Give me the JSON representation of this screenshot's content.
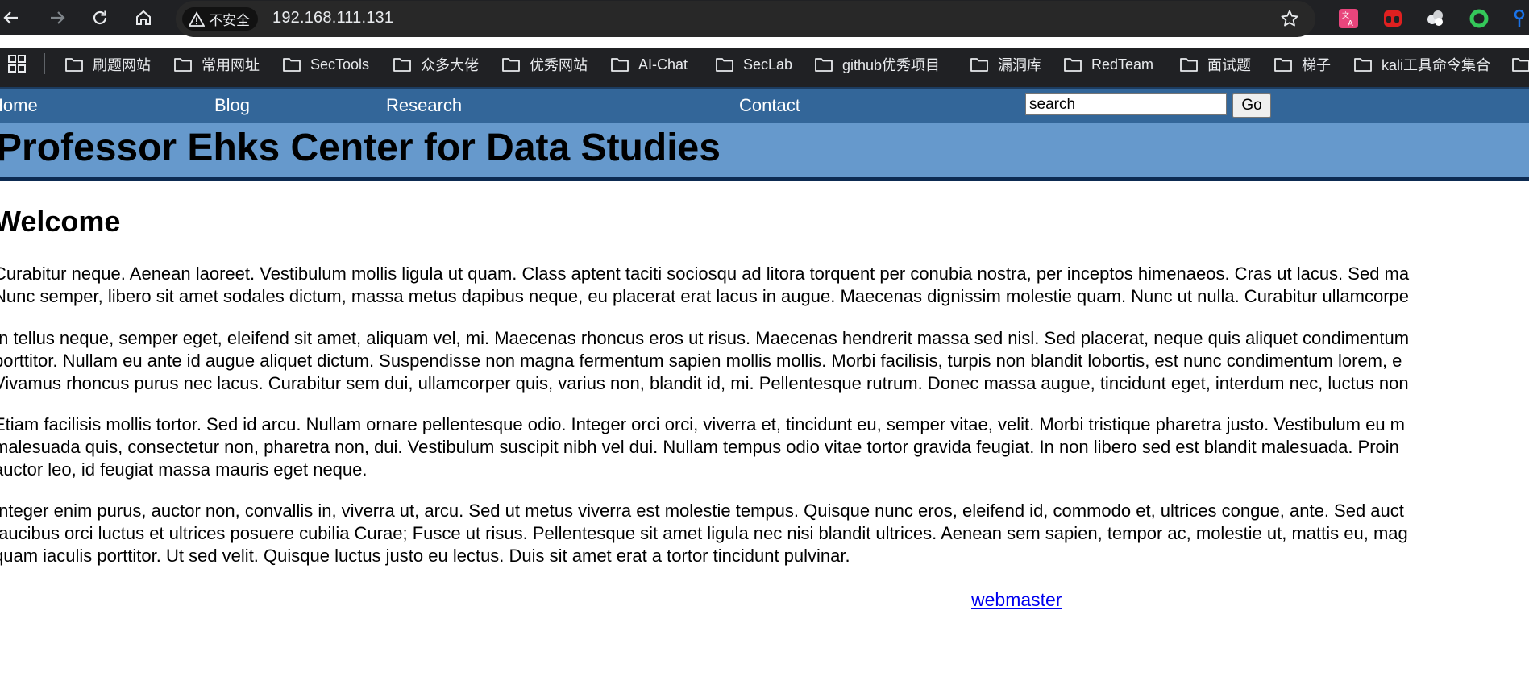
{
  "browser": {
    "security_label": "不安全",
    "url": "192.168.111.131",
    "bookmarks": [
      "刷题网站",
      "常用网址",
      "SecTools",
      "众多大佬",
      "优秀网站",
      "AI-Chat",
      "SecLab",
      "github优秀项目",
      "漏洞库",
      "RedTeam",
      "面试题",
      "梯子",
      "kali工具命令集合"
    ]
  },
  "nav": {
    "items": [
      "Home",
      "Blog",
      "Research",
      "Contact"
    ],
    "search_value": "search",
    "go_label": "Go"
  },
  "banner": {
    "title": "Professor Ehks Center for Data Studies"
  },
  "main": {
    "heading": "Welcome",
    "paragraphs": [
      [
        "Curabitur neque. Aenean laoreet. Vestibulum mollis ligula ut quam. Class aptent taciti sociosqu ad litora torquent per conubia nostra, per inceptos himenaeos. Cras ut lacus. Sed ma",
        "Nunc semper, libero sit amet sodales dictum, massa metus dapibus neque, eu placerat erat lacus in augue. Maecenas dignissim molestie quam. Nunc ut nulla. Curabitur ullamcorpe"
      ],
      [
        "In tellus neque, semper eget, eleifend sit amet, aliquam vel, mi. Maecenas rhoncus eros ut risus. Maecenas hendrerit massa sed nisl. Sed placerat, neque quis aliquet condimentum",
        "porttitor. Nullam eu ante id augue aliquet dictum. Suspendisse non magna fermentum sapien mollis mollis. Morbi facilisis, turpis non blandit lobortis, est nunc condimentum lorem, e",
        "Vivamus rhoncus purus nec lacus. Curabitur sem dui, ullamcorper quis, varius non, blandit id, mi. Pellentesque rutrum. Donec massa augue, tincidunt eget, interdum nec, luctus non"
      ],
      [
        "Etiam facilisis mollis tortor. Sed id arcu. Nullam ornare pellentesque odio. Integer orci orci, viverra et, tincidunt eu, semper vitae, velit. Morbi tristique pharetra justo. Vestibulum eu m",
        "malesuada quis, consectetur non, pharetra non, dui. Vestibulum suscipit nibh vel dui. Nullam tempus odio vitae tortor gravida feugiat. In non libero sed est blandit malesuada. Proin",
        "auctor leo, id feugiat massa mauris eget neque."
      ],
      [
        "Integer enim purus, auctor non, convallis in, viverra ut, arcu. Sed ut metus viverra est molestie tempus. Quisque nunc eros, eleifend id, commodo et, ultrices congue, ante. Sed auct",
        "faucibus orci luctus et ultrices posuere cubilia Curae; Fusce ut risus. Pellentesque sit amet ligula nec nisi blandit ultrices. Aenean sem sapien, tempor ac, molestie ut, mattis eu, mag",
        "quam iaculis porttitor. Ut sed velit. Quisque luctus justo eu lectus. Duis sit amet erat a tortor tincidunt pulvinar."
      ]
    ],
    "webmaster_link": "webmaster"
  },
  "colors": {
    "chrome_bg": "#202124",
    "nav_bg": "#336699",
    "banner_bg": "#6699cc",
    "banner_border": "#0d2b52",
    "link": "#0000ee"
  },
  "icons": {
    "toolbar": [
      "back-arrow-icon",
      "forward-arrow-icon",
      "reload-icon",
      "home-icon"
    ],
    "address": [
      "warning-icon",
      "star-icon"
    ],
    "extensions": [
      "translate-icon",
      "red-extension-icon",
      "cloud-extension-icon",
      "green-ring-icon",
      "key-icon"
    ],
    "bookmarks": [
      "apps-grid-icon",
      "folder-icon"
    ]
  }
}
